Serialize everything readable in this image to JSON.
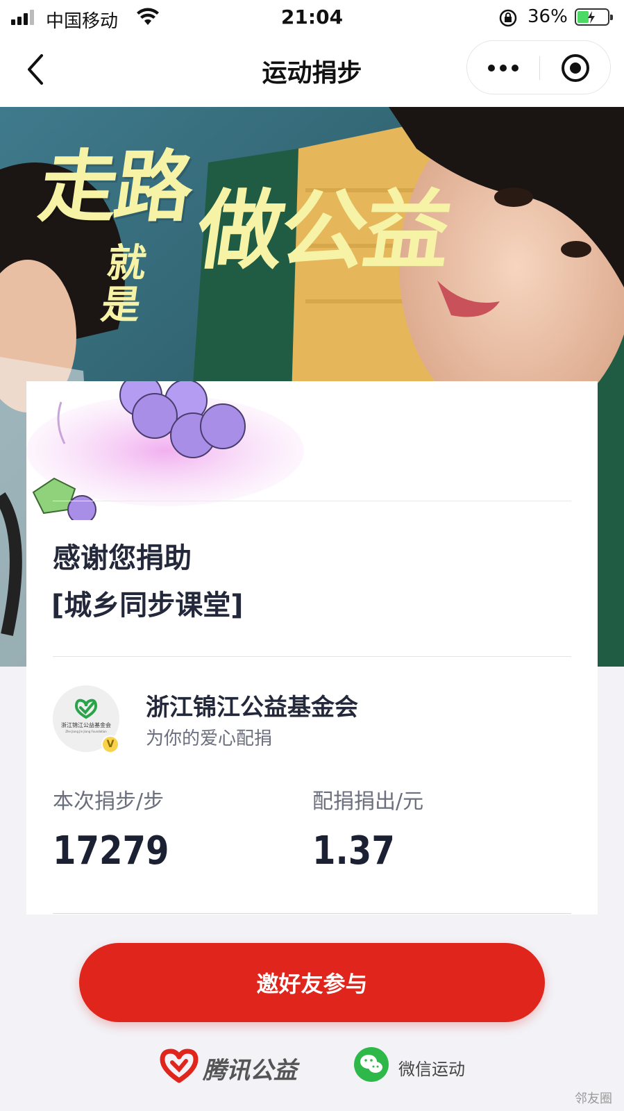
{
  "status_bar": {
    "carrier": "中国移动",
    "time": "21:04",
    "battery_percent": "36%"
  },
  "nav": {
    "title": "运动捐步"
  },
  "banner": {
    "headline_line1": "走路",
    "headline_line2": "就是",
    "headline_line3": "做公益"
  },
  "card": {
    "thanks": "感谢您捐助",
    "project": "[城乡同步课堂]",
    "org": {
      "name": "浙江锦江公益基金会",
      "subtitle": "为你的爱心配捐",
      "logo_text": "浙江锦江公益基金会",
      "logo_subtext": "Zhe Jiang Jin Jiang Foundation",
      "verified_badge": "V"
    },
    "stats": [
      {
        "label": "本次捐步/步",
        "value": "17279"
      },
      {
        "label": "配捐捐出/元",
        "value": "1.37"
      }
    ]
  },
  "invite_button": "邀好友参与",
  "footer": {
    "tencent_label": "腾讯公益",
    "wechat_label": "微信运动"
  },
  "watermark": "邻友圈",
  "colors": {
    "accent_red": "#e0261c",
    "headline_yellow": "#f7f3a6",
    "wechat_green": "#2fb84a"
  }
}
